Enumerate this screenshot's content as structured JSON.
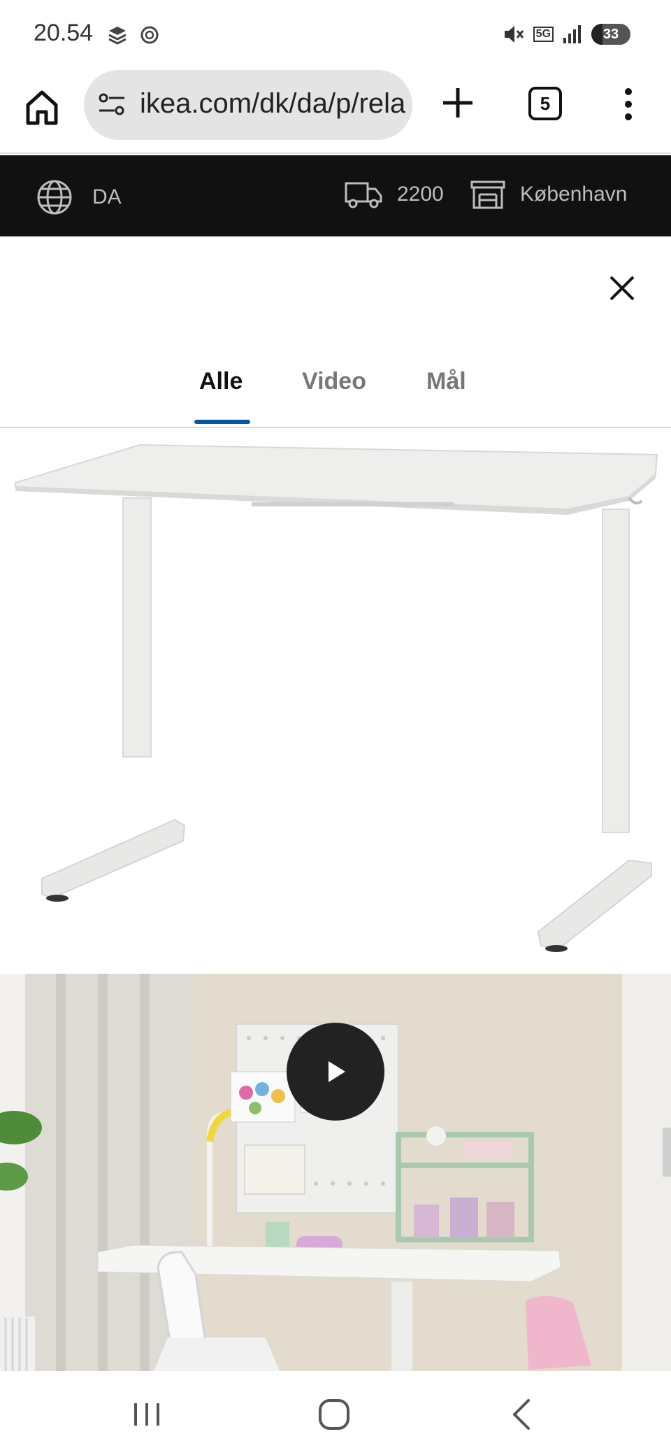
{
  "status_bar": {
    "time": "20.54",
    "battery_level": "33",
    "network": "5G"
  },
  "browser": {
    "url": "ikea.com/dk/da/p/relatera",
    "tab_count": "5"
  },
  "ikea_header": {
    "language": "DA",
    "postal_code": "2200",
    "store": "København"
  },
  "gallery": {
    "tabs": [
      {
        "label": "Alle",
        "active": true
      },
      {
        "label": "Video",
        "active": false
      },
      {
        "label": "Mål",
        "active": false
      }
    ]
  },
  "colors": {
    "accent": "#0058a3",
    "header_bg": "#111111",
    "urlbar_bg": "#e4e4e4"
  }
}
